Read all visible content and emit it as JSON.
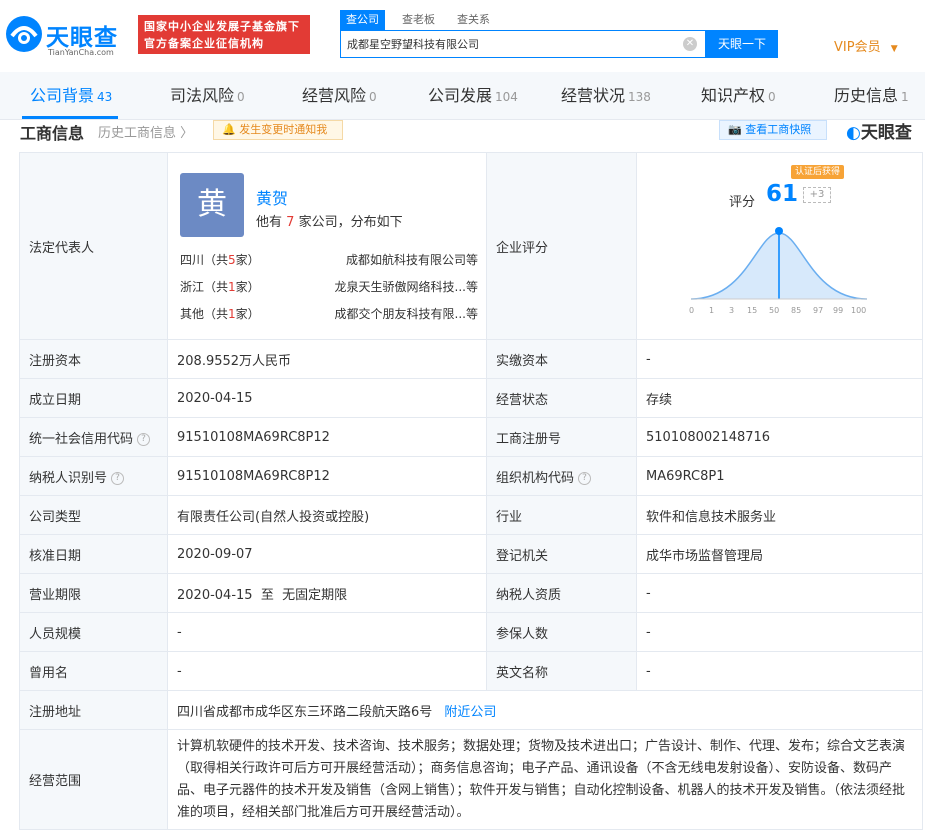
{
  "header": {
    "logo_text": "天眼查",
    "logo_sub": "TianYanCha.com",
    "banner_line1": "国家中小企业发展子基金旗下",
    "banner_line2": "官方备案企业征信机构",
    "search_tabs": [
      "查公司",
      "查老板",
      "查关系"
    ],
    "search_value": "成都星空野望科技有限公司",
    "search_button": "天眼一下",
    "vip": "VIP会员"
  },
  "nav": {
    "tabs": [
      {
        "label": "公司背景",
        "count": "43"
      },
      {
        "label": "司法风险",
        "count": "0"
      },
      {
        "label": "经营风险",
        "count": "0"
      },
      {
        "label": "公司发展",
        "count": "104"
      },
      {
        "label": "经营状况",
        "count": "138"
      },
      {
        "label": "知识产权",
        "count": "0"
      },
      {
        "label": "历史信息",
        "count": "1"
      }
    ]
  },
  "section": {
    "title": "工商信息",
    "history": "历史工商信息",
    "notify": "发生变更时通知我",
    "snapshot": "查看工商快照",
    "brand": "天眼查"
  },
  "rep": {
    "label": "法定代表人",
    "avatar": "黄",
    "name": "黄贺",
    "desc_pre": "他有",
    "desc_num": "7",
    "desc_post": "家公司，分布如下",
    "rows": [
      {
        "region": "四川",
        "count": "5",
        "company": "成都如航科技有限公司等"
      },
      {
        "region": "浙江",
        "count": "1",
        "company": "龙泉天生骄傲网络科技...等"
      },
      {
        "region": "其他",
        "count": "1",
        "company": "成都交个朋友科技有限...等"
      }
    ]
  },
  "score": {
    "label": "企业评分",
    "badge": "认证后获得",
    "score_label": "评分",
    "value": "61",
    "plus": "+3",
    "axis": [
      "0",
      "1",
      "3",
      "15",
      "50",
      "85",
      "97",
      "99",
      "100"
    ]
  },
  "rows": [
    {
      "l1": "注册资本",
      "v1": "208.9552万人民币",
      "l2": "实缴资本",
      "v2": "-"
    },
    {
      "l1": "成立日期",
      "v1": "2020-04-15",
      "l2": "经营状态",
      "v2": "存续"
    },
    {
      "l1": "统一社会信用代码",
      "v1": "91510108MA69RC8P12",
      "l2": "工商注册号",
      "v2": "510108002148716"
    },
    {
      "l1": "纳税人识别号",
      "v1": "91510108MA69RC8P12",
      "l2": "组织机构代码",
      "v2": "MA69RC8P1"
    },
    {
      "l1": "公司类型",
      "v1": "有限责任公司(自然人投资或控股)",
      "l2": "行业",
      "v2": "软件和信息技术服务业"
    },
    {
      "l1": "核准日期",
      "v1": "2020-09-07",
      "l2": "登记机关",
      "v2": "成华市场监督管理局"
    },
    {
      "l1": "营业期限",
      "v1": "2020-04-15  至  无固定期限",
      "l2": "纳税人资质",
      "v2": "-"
    },
    {
      "l1": "人员规模",
      "v1": "-",
      "l2": "参保人数",
      "v2": "-"
    },
    {
      "l1": "曾用名",
      "v1": "-",
      "l2": "英文名称",
      "v2": "-"
    }
  ],
  "address": {
    "label": "注册地址",
    "value": "四川省成都市成华区东三环路二段航天路6号",
    "link": "附近公司"
  },
  "scope": {
    "label": "经营范围",
    "value": "计算机软硬件的技术开发、技术咨询、技术服务；数据处理；货物及技术进出口；广告设计、制作、代理、发布；综合文艺表演（取得相关行政许可后方可开展经营活动）；商务信息咨询；电子产品、通讯设备（不含无线电发射设备）、安防设备、数码产品、电子元器件的技术开发及销售（含网上销售）；软件开发与销售；自动化控制设备、机器人的技术开发及销售。（依法须经批准的项目，经相关部门批准后方可开展经营活动）。"
  },
  "colors": {
    "accent": "#0084ff",
    "red": "#e23b35",
    "orange": "#e58a1f"
  }
}
